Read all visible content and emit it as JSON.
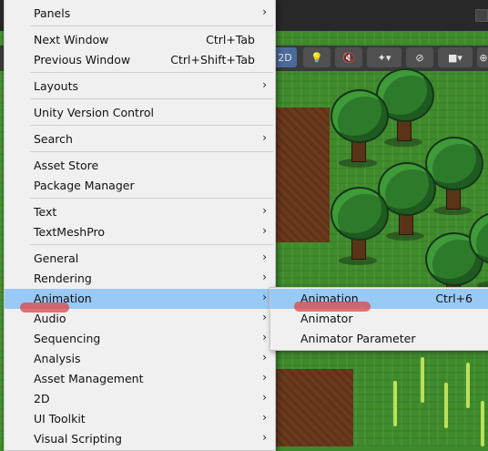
{
  "menu": {
    "items": [
      {
        "label": "Panels",
        "submenu": true
      },
      {
        "label": "Next Window",
        "shortcut": "Ctrl+Tab"
      },
      {
        "label": "Previous Window",
        "shortcut": "Ctrl+Shift+Tab"
      },
      {
        "label": "Layouts",
        "submenu": true
      },
      {
        "label": "Unity Version Control"
      },
      {
        "label": "Search",
        "submenu": true
      },
      {
        "label": "Asset Store"
      },
      {
        "label": "Package Manager"
      },
      {
        "label": "Text",
        "submenu": true
      },
      {
        "label": "TextMeshPro",
        "submenu": true
      },
      {
        "label": "General",
        "submenu": true
      },
      {
        "label": "Rendering",
        "submenu": true
      },
      {
        "label": "Animation",
        "submenu": true,
        "highlighted": true
      },
      {
        "label": "Audio",
        "submenu": true
      },
      {
        "label": "Sequencing",
        "submenu": true
      },
      {
        "label": "Analysis",
        "submenu": true
      },
      {
        "label": "Asset Management",
        "submenu": true
      },
      {
        "label": "2D",
        "submenu": true
      },
      {
        "label": "UI Toolkit",
        "submenu": true
      },
      {
        "label": "Visual Scripting",
        "submenu": true
      }
    ]
  },
  "submenu": {
    "items": [
      {
        "label": "Animation",
        "shortcut": "Ctrl+6",
        "highlighted": true
      },
      {
        "label": "Animator"
      },
      {
        "label": "Animator Parameter"
      }
    ]
  },
  "toolbar": {
    "mode_2d": "2D"
  },
  "arrow_glyph": "›",
  "colors": {
    "menu_bg": "#f0f0f0",
    "highlight": "#99c9f5",
    "annotation": "#de4646"
  }
}
